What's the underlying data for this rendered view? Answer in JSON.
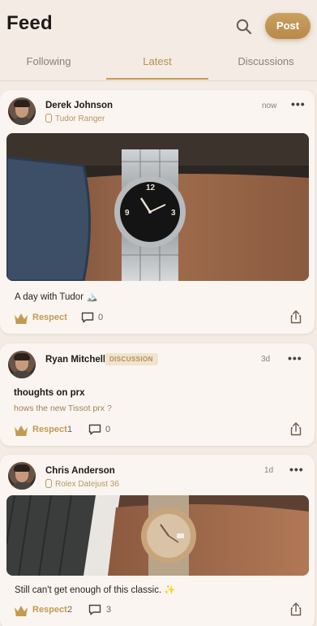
{
  "header": {
    "title": "Feed",
    "post_label": "Post"
  },
  "tabs": [
    {
      "label": "Following",
      "active": false
    },
    {
      "label": "Latest",
      "active": true
    },
    {
      "label": "Discussions",
      "active": false
    }
  ],
  "posts": [
    {
      "author": "Derek Johnson",
      "watch": "Tudor Ranger",
      "time": "now",
      "caption": "A day with Tudor 🏔️",
      "respect_label": "Respect",
      "respect_count": "",
      "comment_count": "0"
    },
    {
      "author": "Ryan Mitchell",
      "badge": "DISCUSSION",
      "time": "3d",
      "title": "thoughts on prx",
      "body": "hows the new Tissot prx ?",
      "respect_label": "Respect",
      "respect_count": "1",
      "comment_count": "0"
    },
    {
      "author": "Chris Anderson",
      "watch": "Rolex Datejust 36",
      "time": "1d",
      "caption": "Still can't get enough of this classic. ✨",
      "respect_label": "Respect",
      "respect_count": "2",
      "comment_count": "3"
    }
  ],
  "colors": {
    "accent": "#c29b56",
    "background": "#f3ebe4",
    "card": "#faf5f1"
  },
  "icons": [
    "search-icon",
    "crown-icon",
    "comment-icon",
    "share-icon",
    "more-icon",
    "watch-icon"
  ]
}
